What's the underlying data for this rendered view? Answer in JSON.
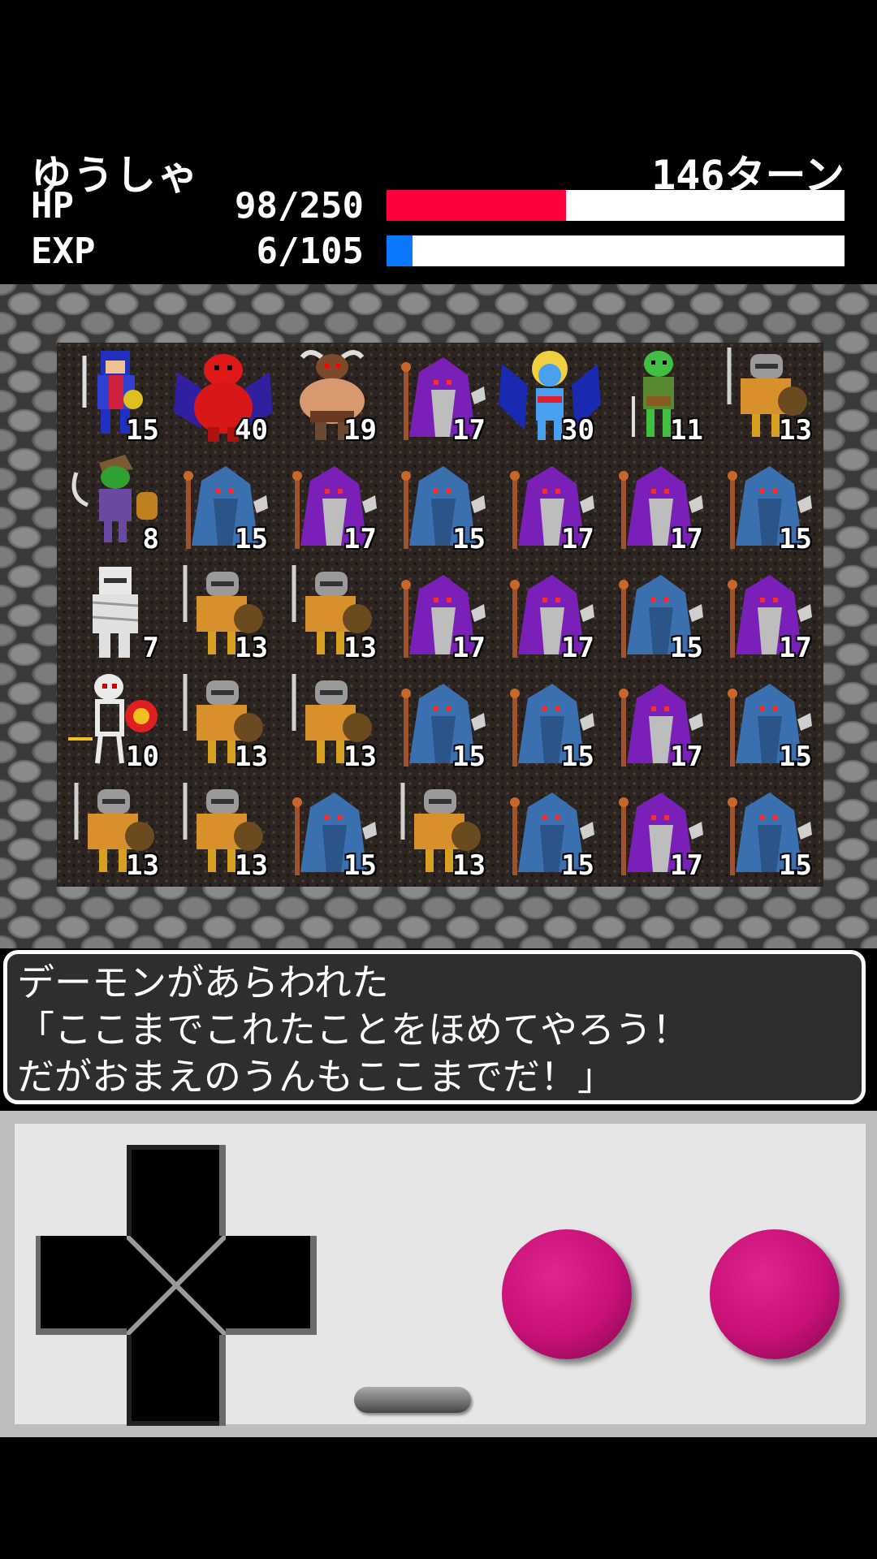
{
  "status": {
    "hero_name": "ゆうしゃ",
    "turn": "146ターン",
    "hp": {
      "label": "HP",
      "value": "98/250",
      "fraction": 0.392,
      "color": "#ff003c"
    },
    "exp": {
      "label": "EXP",
      "value": "6/105",
      "fraction": 0.057,
      "color": "#0a78ff"
    }
  },
  "board": {
    "rows": [
      [
        {
          "kind": "hero",
          "n": "15"
        },
        {
          "kind": "demon",
          "n": "40"
        },
        {
          "kind": "minotaur",
          "n": "19"
        },
        {
          "kind": "purple-mage",
          "n": "17"
        },
        {
          "kind": "succubus",
          "n": "30"
        },
        {
          "kind": "goblin",
          "n": "11"
        },
        {
          "kind": "knight",
          "n": "13"
        }
      ],
      [
        {
          "kind": "goblin-warrior",
          "n": "8"
        },
        {
          "kind": "blue-mage",
          "n": "15"
        },
        {
          "kind": "purple-mage",
          "n": "17"
        },
        {
          "kind": "blue-mage",
          "n": "15"
        },
        {
          "kind": "purple-mage",
          "n": "17"
        },
        {
          "kind": "purple-mage",
          "n": "17"
        },
        {
          "kind": "blue-mage",
          "n": "15"
        }
      ],
      [
        {
          "kind": "mummy",
          "n": "7"
        },
        {
          "kind": "knight",
          "n": "13"
        },
        {
          "kind": "knight",
          "n": "13"
        },
        {
          "kind": "purple-mage",
          "n": "17"
        },
        {
          "kind": "purple-mage",
          "n": "17"
        },
        {
          "kind": "blue-mage",
          "n": "15"
        },
        {
          "kind": "purple-mage",
          "n": "17"
        }
      ],
      [
        {
          "kind": "skeleton",
          "n": "10"
        },
        {
          "kind": "knight",
          "n": "13"
        },
        {
          "kind": "knight",
          "n": "13"
        },
        {
          "kind": "blue-mage",
          "n": "15"
        },
        {
          "kind": "blue-mage",
          "n": "15"
        },
        {
          "kind": "purple-mage",
          "n": "17"
        },
        {
          "kind": "blue-mage",
          "n": "15"
        }
      ],
      [
        {
          "kind": "knight",
          "n": "13"
        },
        {
          "kind": "knight",
          "n": "13"
        },
        {
          "kind": "blue-mage",
          "n": "15"
        },
        {
          "kind": "knight",
          "n": "13"
        },
        {
          "kind": "blue-mage",
          "n": "15"
        },
        {
          "kind": "purple-mage",
          "n": "17"
        },
        {
          "kind": "blue-mage",
          "n": "15"
        }
      ]
    ]
  },
  "message": {
    "line1": "デーモンがあらわれた",
    "line2": "「ここまでこれたことをほめてやろう！",
    "line3": "だがおまえのうんもここまでだ！」"
  },
  "controls": {
    "dpad_icon": "dpad-icon",
    "button_color": "#c81078"
  }
}
